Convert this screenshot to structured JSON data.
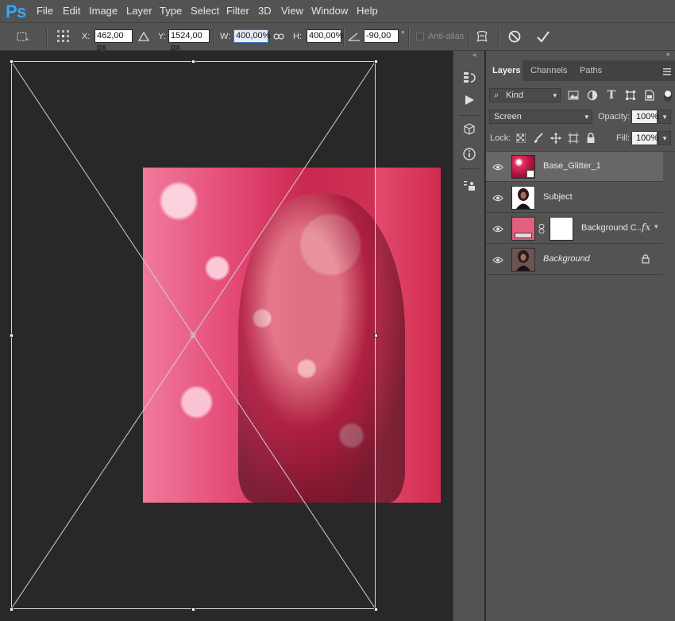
{
  "app": {
    "logo": "Ps"
  },
  "menu": [
    "File",
    "Edit",
    "Image",
    "Layer",
    "Type",
    "Select",
    "Filter",
    "3D",
    "View",
    "Window",
    "Help"
  ],
  "options": {
    "x_label": "X:",
    "x_value": "462,00 px",
    "y_label": "Y:",
    "y_value": "1524,00 px",
    "w_label": "W:",
    "w_value": "400,00%",
    "h_label": "H:",
    "h_value": "400,00%",
    "angle_value": "-90,00",
    "angle_unit": "°",
    "antialias_label": "Anti-alias"
  },
  "panel": {
    "tabs": [
      "Layers",
      "Channels",
      "Paths"
    ],
    "kind_label": "Kind",
    "blend_mode": "Screen",
    "opacity_label": "Opacity:",
    "opacity_value": "100%",
    "lock_label": "Lock:",
    "fill_label": "Fill:",
    "fill_value": "100%",
    "layers": [
      {
        "name": "Base_Glitter_1",
        "selected": true
      },
      {
        "name": "Subject"
      },
      {
        "name": "Background C...",
        "fx": "fx"
      },
      {
        "name": "Background",
        "locked": true
      }
    ]
  },
  "colors": {
    "chrome": "#535353",
    "canvas_bg": "#282828",
    "accent": "#31a8ff",
    "photo_pink": "#d43a5c"
  }
}
